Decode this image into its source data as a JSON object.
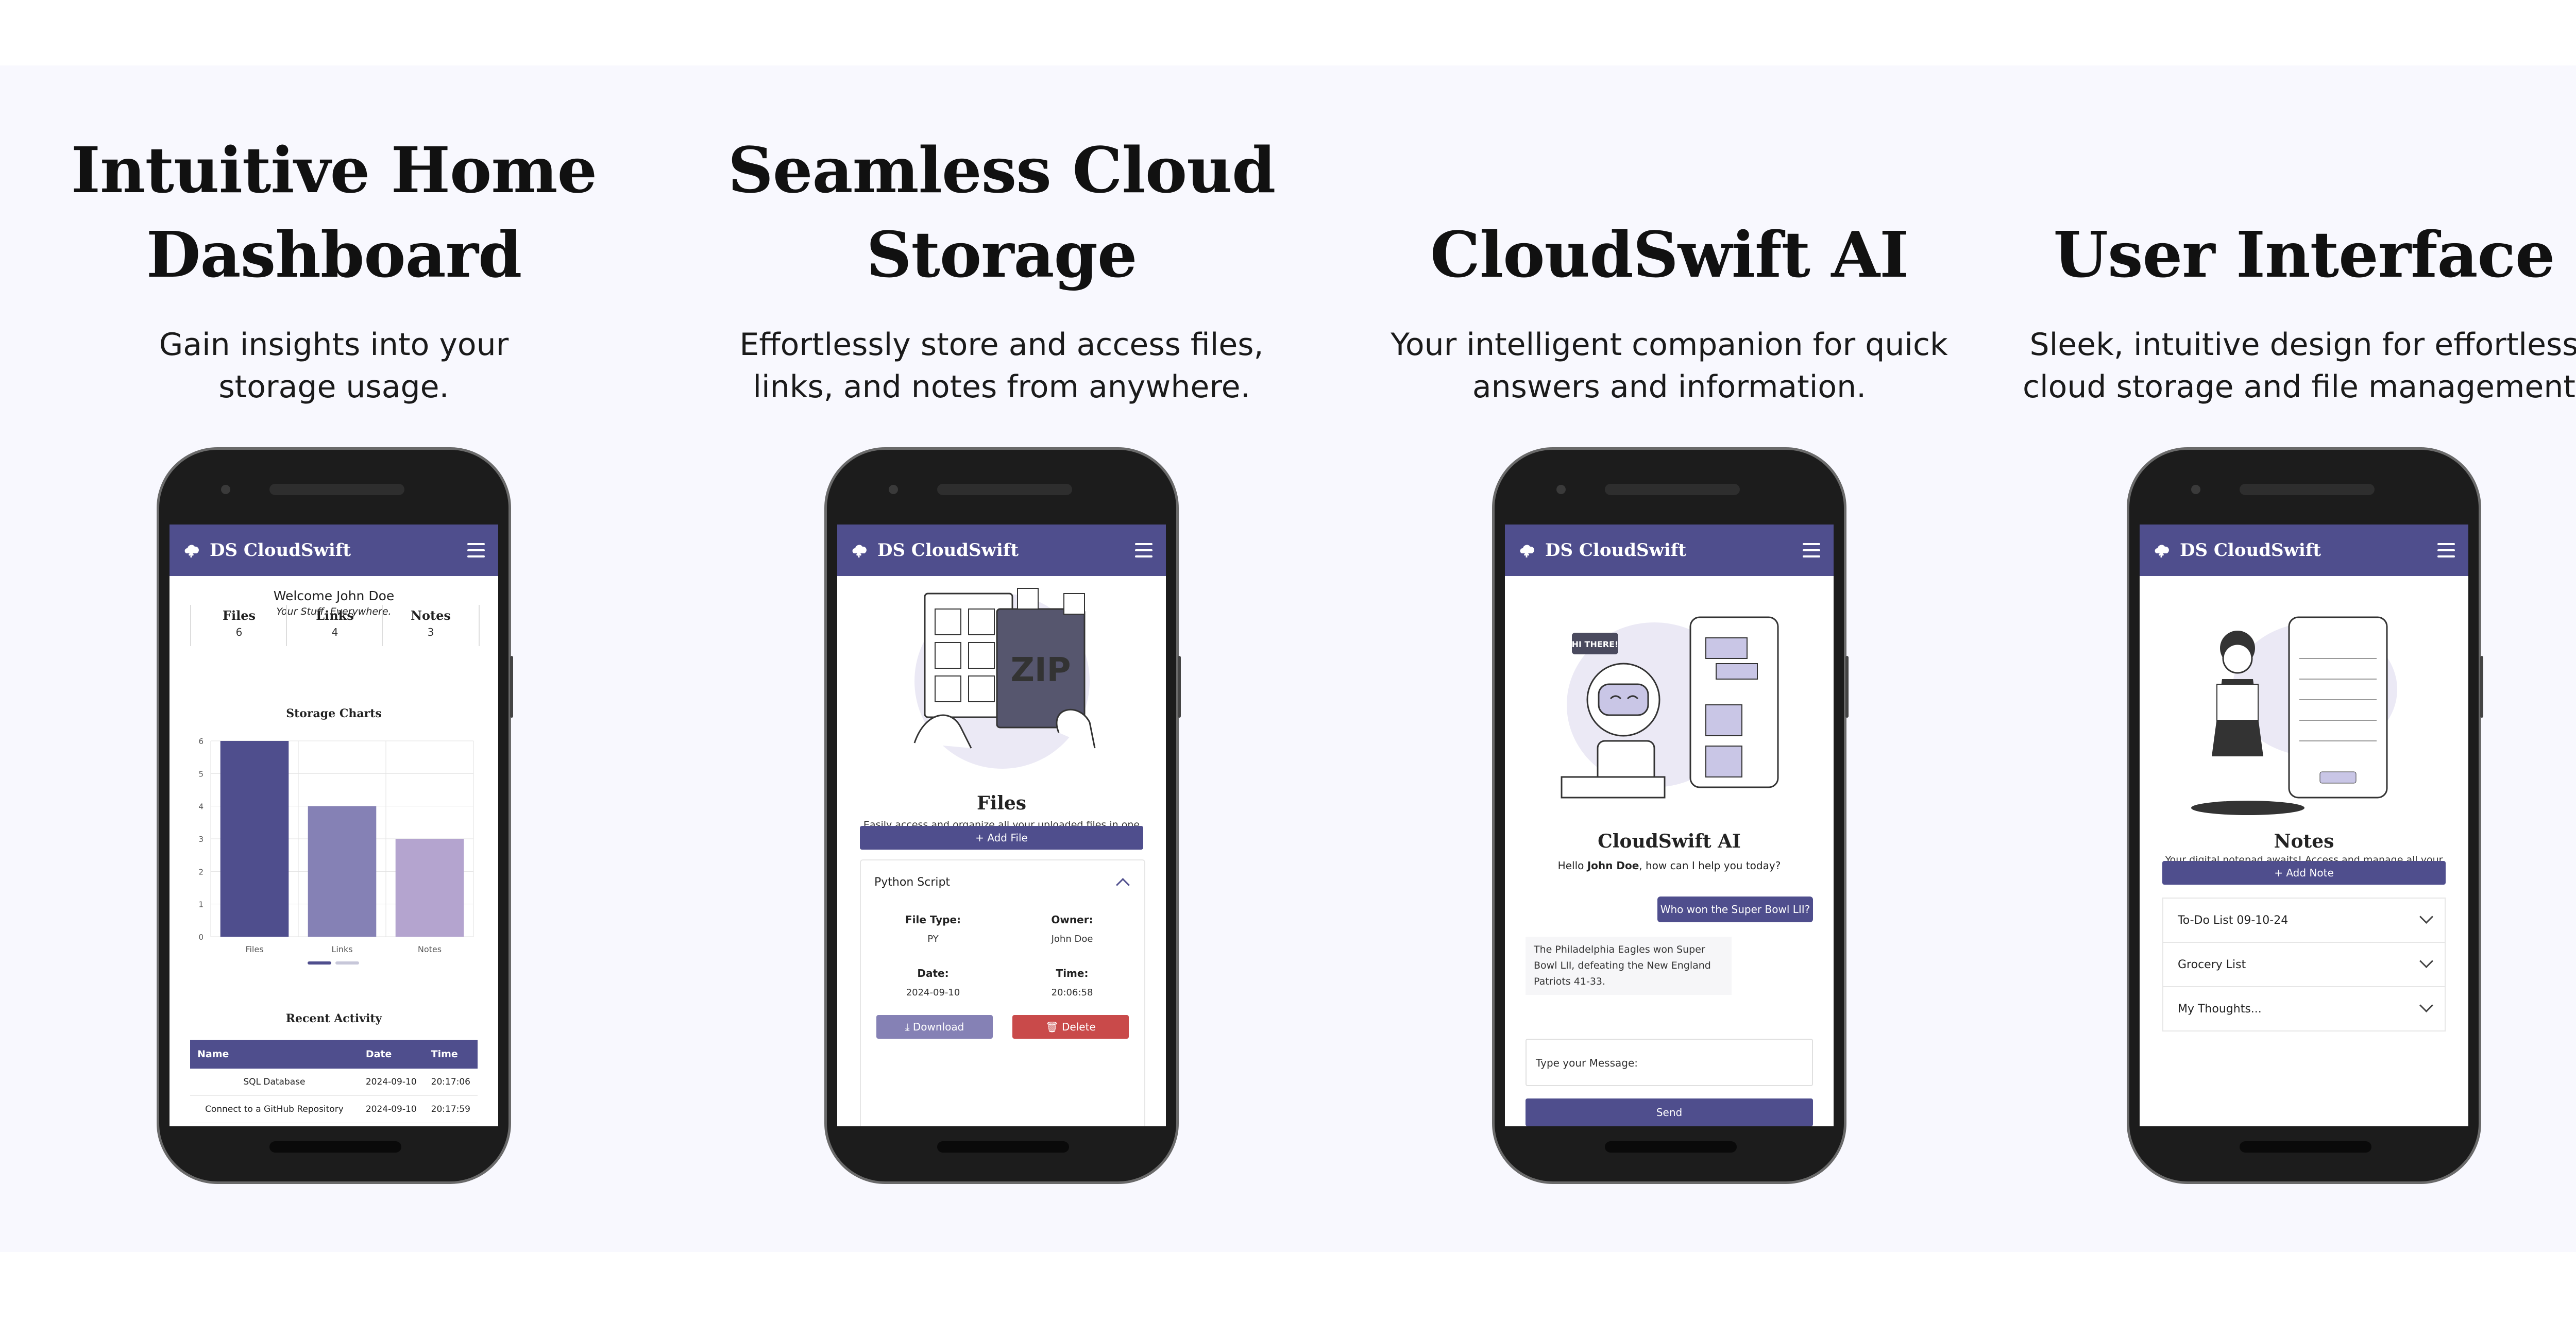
{
  "columns": [
    {
      "title": "Intuitive Home\nDashboard",
      "subtitle": "Gain insights into your\nstorage usage.",
      "app_name": "DS CloudSwift",
      "welcome_prefix": "Welcome ",
      "user_name": "John Doe",
      "tagline": "Your Stuff. Everywhere.",
      "stats": [
        {
          "label": "Files",
          "value": "6"
        },
        {
          "label": "Links",
          "value": "4"
        },
        {
          "label": "Notes",
          "value": "3"
        }
      ],
      "chart_title": "Storage Charts",
      "recent_title": "Recent Activity",
      "table_headers": [
        "Name",
        "Date",
        "Time"
      ],
      "table_rows": [
        [
          "SQL Database",
          "2024-09-10",
          "20:17:06"
        ],
        [
          "Connect to a GitHub Repository",
          "2024-09-10",
          "20:17:59"
        ]
      ]
    },
    {
      "title": "Seamless Cloud\nStorage",
      "subtitle": "Effortlessly store and access files,\nlinks, and notes from anywhere.",
      "app_name": "DS CloudSwift",
      "section_title": "Files",
      "section_desc": "Easily access and organize all your uploaded files in one convenient location.",
      "add_button": "+ Add File",
      "file_name": "Python Script",
      "fields": [
        {
          "key": "File Type:",
          "value": "PY"
        },
        {
          "key": "Owner:",
          "value": "John Doe"
        },
        {
          "key": "Date:",
          "value": "2024-09-10"
        },
        {
          "key": "Time:",
          "value": "20:06:58"
        }
      ],
      "download_label": "Download",
      "delete_label": "Delete",
      "illustration_text": "ZIP"
    },
    {
      "title": "CloudSwift AI",
      "subtitle": "Your intelligent companion for quick\nanswers and information.",
      "app_name": "DS CloudSwift",
      "section_title": "CloudSwift AI",
      "greeting_prefix": "Hello ",
      "user_name": "John Doe",
      "greeting_suffix": ", how can I help you today?",
      "user_message": "Who won the Super Bowl LII?",
      "ai_message": "The Philadelphia Eagles won Super Bowl LII, defeating the New England Patriots 41-33.",
      "input_placeholder": "Type your Message:",
      "send_label": "Send",
      "illustration_bubble": "HI THERE!"
    },
    {
      "title": "User Interface",
      "subtitle": "Sleek, intuitive design for effortless\ncloud storage and file management.",
      "app_name": "DS CloudSwift",
      "section_title": "Notes",
      "section_desc": "Your digital notepad awaits! Access and manage all your saved notes effortlessly in one central hub.",
      "add_button": "+ Add Note",
      "notes": [
        "To-Do List 09-10-24",
        "Grocery List",
        "My Thoughts..."
      ]
    }
  ],
  "chart_data": {
    "type": "bar",
    "categories": [
      "Files",
      "Links",
      "Notes"
    ],
    "values": [
      6,
      4,
      3
    ],
    "ylim": [
      0,
      6
    ],
    "yticks": [
      0,
      1,
      2,
      3,
      4,
      5,
      6
    ],
    "colors": [
      "#4f4e8d",
      "#8581b5",
      "#b4a4cf"
    ],
    "grid": true
  },
  "colors": {
    "brand": "#4f4e8d",
    "danger": "#c94a4a",
    "muted_button": "#8581b5",
    "background_band": "#f8f8fe"
  }
}
